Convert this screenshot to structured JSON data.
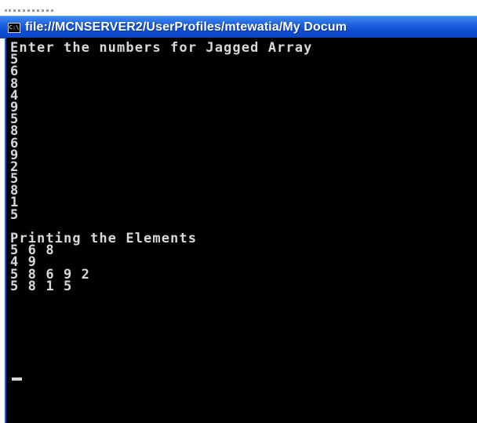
{
  "window": {
    "title": "file://MCNSERVER2/UserProfiles/mtewatia/My Docum",
    "icon": "console-icon",
    "icon_glyph": "C:\\"
  },
  "console": {
    "lines": [
      "Enter the numbers for Jagged Array",
      "5",
      "6",
      "8",
      "4",
      "9",
      "5",
      "8",
      "6",
      "9",
      "2",
      "5",
      "8",
      "1",
      "5",
      "",
      "Printing the Elements",
      "5 6 8",
      "4 9",
      "5 8 6 9 2",
      "5 8 1 5"
    ],
    "background_color": "#000000",
    "text_color": "#d8d8d8"
  }
}
